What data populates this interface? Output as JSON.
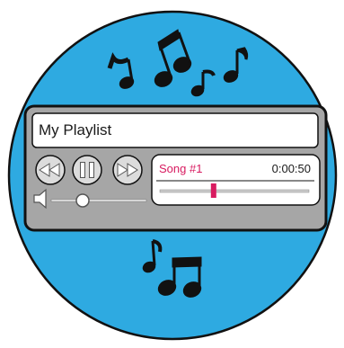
{
  "colors": {
    "background_circle": "#2eaae1",
    "panel": "#a6a6a6",
    "panel_outline": "#111111",
    "button_fill": "#dcdcdc",
    "display_fill": "#ffffff",
    "accent": "#d81b60",
    "music_note": "#111111"
  },
  "player": {
    "playlist_title": "My Playlist",
    "now_playing": {
      "song": "Song #1",
      "time": "0:00:50",
      "progress": 0.36
    },
    "volume": {
      "level": 0.33
    },
    "controls": {
      "rewind_icon": "rewind-icon",
      "pause_icon": "pause-icon",
      "fast_forward_icon": "fast-forward-icon",
      "speaker_icon": "speaker-icon"
    }
  }
}
